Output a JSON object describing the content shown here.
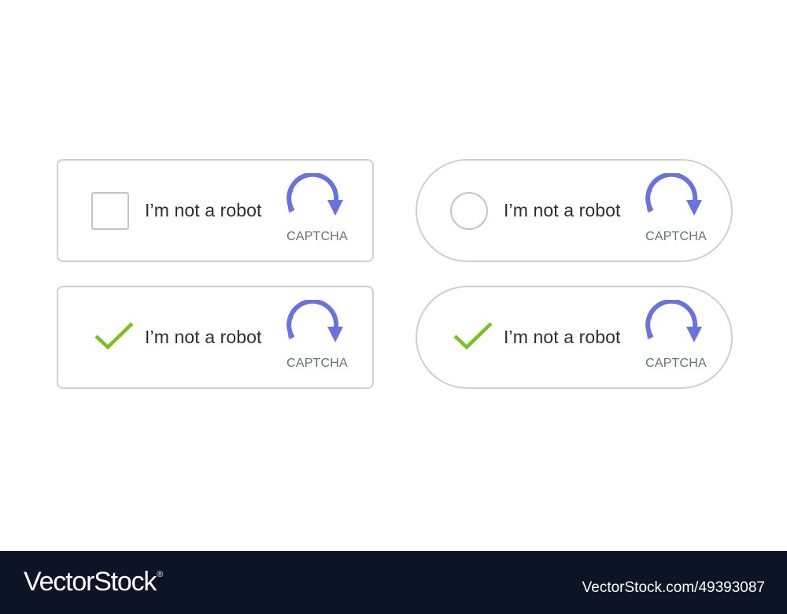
{
  "widgets": [
    {
      "control": "checkbox",
      "state": "unchecked",
      "label": "I’m not a robot",
      "brand_text": "CAPTCHA",
      "icon": "captcha-refresh-icon"
    },
    {
      "control": "radio",
      "state": "unchecked",
      "label": "I’m not a robot",
      "brand_text": "CAPTCHA",
      "icon": "captcha-refresh-icon"
    },
    {
      "control": "checkmark",
      "state": "checked",
      "label": "I’m not a robot",
      "brand_text": "CAPTCHA",
      "icon": "captcha-refresh-icon"
    },
    {
      "control": "checkmark",
      "state": "checked",
      "label": "I’m not a robot",
      "brand_text": "CAPTCHA",
      "icon": "captcha-refresh-icon"
    }
  ],
  "colors": {
    "accent": "#6a73dd",
    "check": "#79c11f",
    "border": "#cfcfcf",
    "footer_bg": "#0c1426"
  },
  "footer": {
    "brand": "VectorStock",
    "registered_mark": "®",
    "image_id": "VectorStock.com/49393087"
  }
}
